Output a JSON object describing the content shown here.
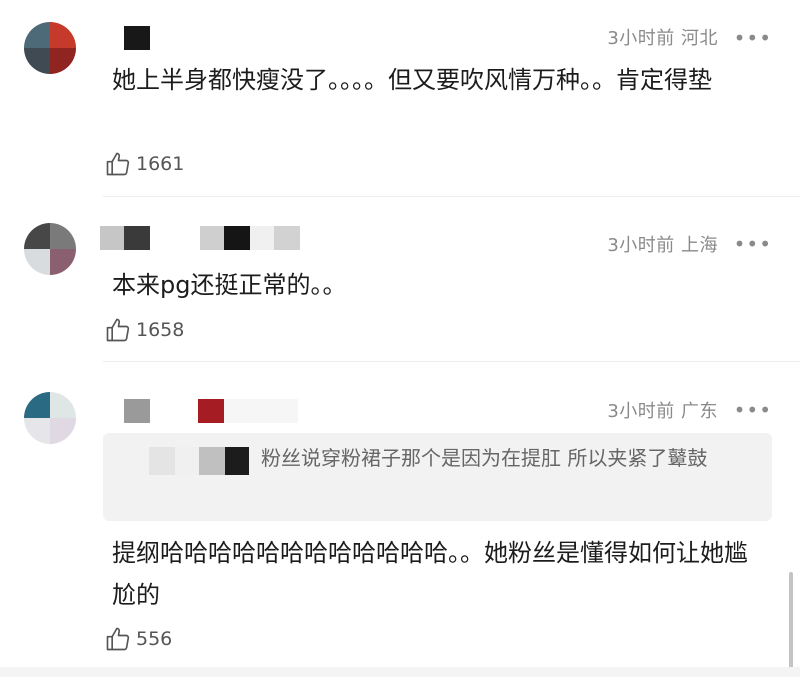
{
  "comments": [
    {
      "meta": "3小时前 河北",
      "text": "她上半身都快瘦没了。。。。但又要吹风情万种。。肯定得垫",
      "likes": "1661"
    },
    {
      "meta": "3小时前 上海",
      "text": "本来pg还挺正常的。。",
      "likes": "1658"
    },
    {
      "meta": "3小时前 广东",
      "quote": "粉丝说穿粉裙子那个是因为在提肛 所以夹紧了鼙鼓",
      "text": "提纲哈哈哈哈哈哈哈哈哈哈哈哈。。她粉丝是懂得如何让她尴尬的",
      "likes": "556"
    }
  ],
  "more_glyph": "•••",
  "icons": {
    "like": "thumbs-up-icon",
    "more": "more-dots-icon"
  },
  "colors": {
    "meta": "#8a8a8a",
    "quote_bg": "#f2f2f2",
    "divider": "#ececec"
  }
}
